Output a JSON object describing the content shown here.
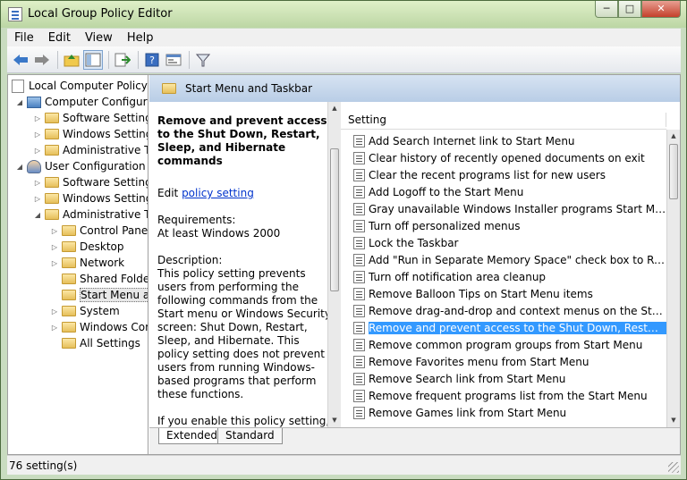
{
  "window": {
    "title": "Local Group Policy Editor",
    "min": "─",
    "max": "□",
    "close": "✕"
  },
  "menu": [
    "File",
    "Edit",
    "View",
    "Help"
  ],
  "toolbar": [
    "back-icon",
    "forward-icon",
    "up-folder-icon",
    "show-hide-tree-icon",
    "export-list-icon",
    "help-icon",
    "properties-icon",
    "filter-icon"
  ],
  "tree": {
    "root": "Local Computer Policy",
    "computer": "Computer Configura",
    "computer_children": [
      "Software Settings",
      "Windows Setting",
      "Administrative Te"
    ],
    "user": "User Configuration",
    "user_children": [
      "Software Settings",
      "Windows Setting",
      "Administrative Te"
    ],
    "admin_children": [
      "Control Panel",
      "Desktop",
      "Network",
      "Shared Folder",
      "Start Menu ar",
      "System",
      "Windows Com",
      "All Settings"
    ]
  },
  "header": {
    "title": "Start Menu and Taskbar"
  },
  "description": {
    "title": "Remove and prevent access to the Shut Down, Restart, Sleep, and Hibernate commands",
    "edit_prefix": "Edit ",
    "edit_link": "policy setting",
    "req_label": "Requirements:",
    "req_value": "At least Windows 2000",
    "desc_label": "Description:",
    "desc_text": "This policy setting prevents users from performing the following commands from the Start menu or Windows Security screen: Shut Down, Restart, Sleep, and Hibernate. This policy setting does not prevent users from running Windows-based programs that perform these functions.",
    "more_text": "If you enable this policy setting, the Power button and the Shut Down, Restart, Sleep, and Hibernate commands are"
  },
  "list": {
    "column": "Setting",
    "rows": [
      "Add Search Internet link to Start Menu",
      "Clear history of recently opened documents on exit",
      "Clear the recent programs list for new users",
      "Add Logoff to the Start Menu",
      "Gray unavailable Windows Installer programs Start Menu sh...",
      "Turn off personalized menus",
      "Lock the Taskbar",
      "Add \"Run in Separate Memory Space\" check box to Run dial...",
      "Turn off notification area cleanup",
      "Remove Balloon Tips on Start Menu items",
      "Remove drag-and-drop and context menus on the Start Me...",
      "Remove and prevent access to the Shut Down, Restart, Sleep...",
      "Remove common program groups from Start Menu",
      "Remove Favorites menu from Start Menu",
      "Remove Search link from Start Menu",
      "Remove frequent programs list from the Start Menu",
      "Remove Games link from Start Menu"
    ],
    "selected_index": 11
  },
  "tabs": [
    "Extended",
    "Standard"
  ],
  "status": "76 setting(s)"
}
